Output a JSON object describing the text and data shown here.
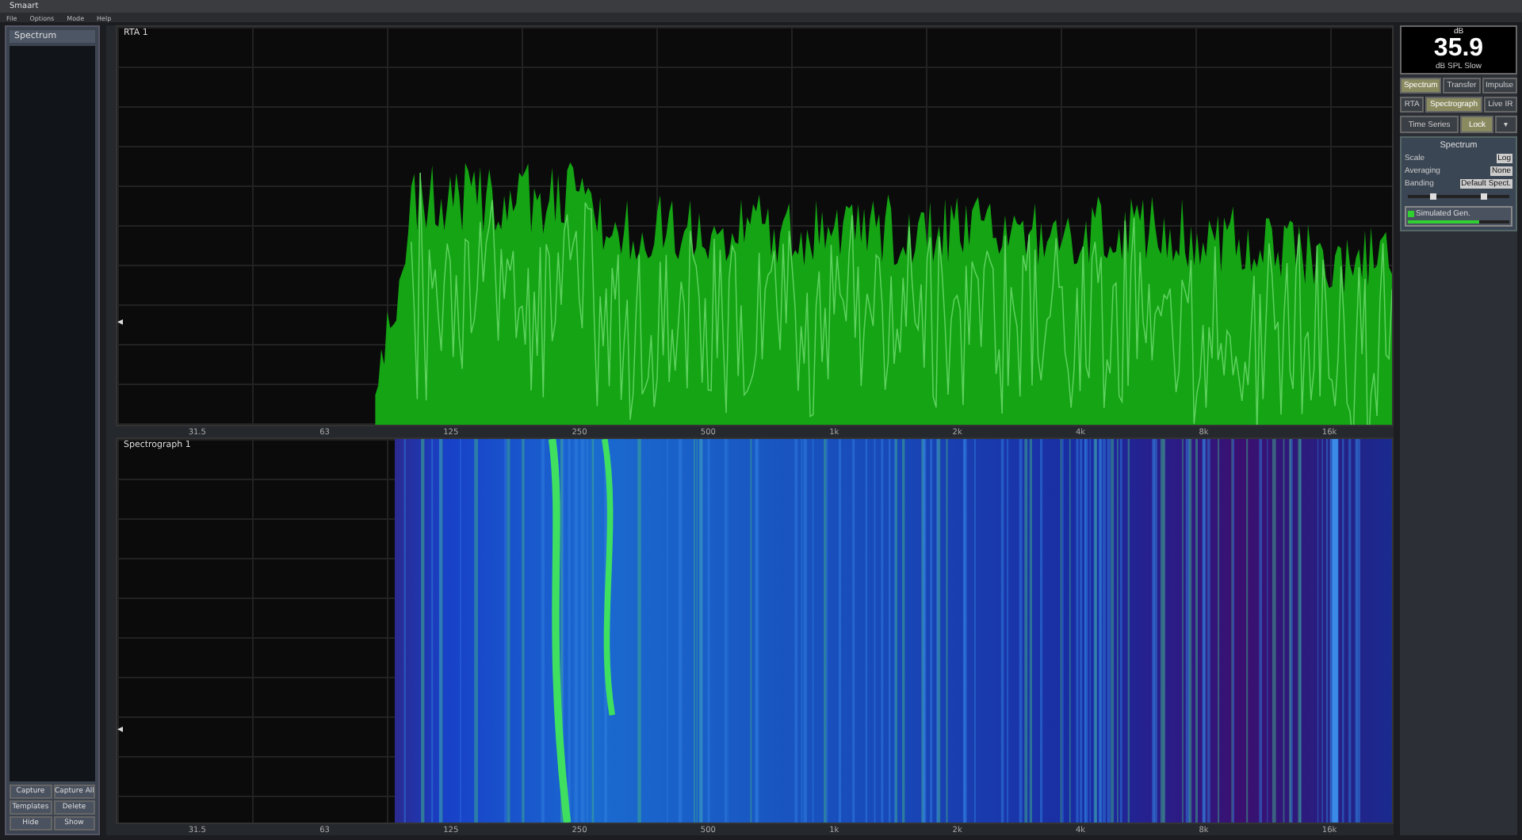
{
  "window": {
    "title": "Smaart"
  },
  "menu": [
    "File",
    "Options",
    "Mode",
    "Help"
  ],
  "left_panel": {
    "title": "Spectrum",
    "buttons": [
      "Capture",
      "Capture All",
      "Templates",
      "Delete",
      "Hide",
      "Show"
    ]
  },
  "spectrum_plot": {
    "title": "RTA 1",
    "marker": "◂",
    "x_labels": [
      "31.5",
      "63",
      "125",
      "250",
      "500",
      "1k",
      "2k",
      "4k",
      "8k",
      "16k"
    ]
  },
  "spectrograph": {
    "title": "Spectrograph 1",
    "marker": "◂",
    "x_labels": [
      "31.5",
      "63",
      "125",
      "250",
      "500",
      "1k",
      "2k",
      "4k",
      "8k",
      "16k"
    ]
  },
  "meter": {
    "unit": "dB",
    "reading": "35.9",
    "caption": "dB SPL Slow"
  },
  "mode_tabs": [
    {
      "label": "Spectrum",
      "selected": true
    },
    {
      "label": "Transfer",
      "selected": false
    },
    {
      "label": "Impulse",
      "selected": false
    }
  ],
  "view_buttons": [
    {
      "label": "RTA",
      "selected": false
    },
    {
      "label": "Spectrograph",
      "selected": true
    },
    {
      "label": "Live IR",
      "selected": false
    }
  ],
  "time_buttons": [
    {
      "label": "Time Series",
      "selected": false
    },
    {
      "label": "Lock",
      "selected": true
    },
    {
      "label": "▾",
      "selected": false
    }
  ],
  "settings": {
    "title": "Spectrum",
    "fields": [
      {
        "label": "Scale",
        "value": "Log"
      },
      {
        "label": "Averaging",
        "value": "None"
      },
      {
        "label": "Banding",
        "value": "Default Spect."
      }
    ]
  },
  "slider": {
    "thumbs": [
      {
        "level": 0.25
      },
      {
        "level": 0.75
      }
    ]
  },
  "generator": {
    "label": "Simulated Gen.",
    "on": true,
    "level": 0.7
  }
}
